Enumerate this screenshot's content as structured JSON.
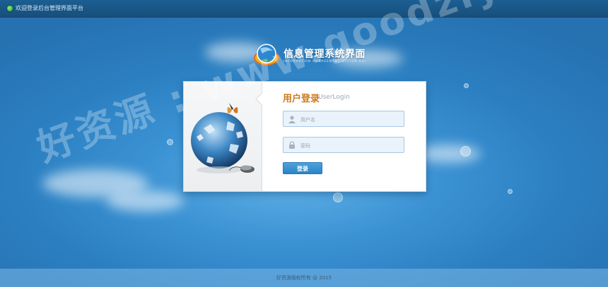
{
  "topbar": {
    "title": "欢迎登录后台管理界面平台"
  },
  "brand": {
    "title": "信息管理系统界面",
    "subtitle": "INFORMATION MANAGEMENT SYSTEM GUI"
  },
  "login": {
    "title": "用户登录",
    "subtitle": "UserLogin",
    "username_placeholder": "用户名",
    "password_placeholder": "密码",
    "button_label": "登录"
  },
  "footer": {
    "copyright": "好资源版权所有 @ 2015"
  },
  "watermark": {
    "text": "好资源 : www.goodziyuan.com"
  },
  "colors": {
    "accent": "#2b83c5",
    "title_orange": "#ce7a1a",
    "background": "#3b92d3"
  }
}
